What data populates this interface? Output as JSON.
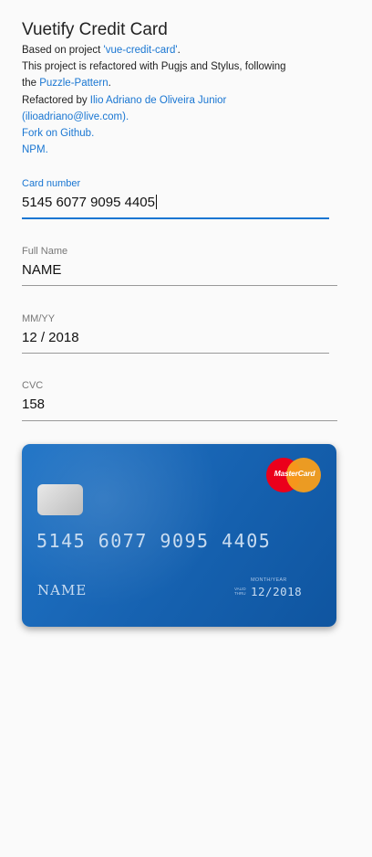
{
  "title": "Vuetify Credit Card",
  "intro": {
    "l1_text": "Based on project ",
    "l1_link": "'vue-credit-card'",
    "l1_end": ".",
    "l2_text": "This project is refactored with Pugjs and Stylus, following",
    "l3_text": "the ",
    "l3_link": "Puzzle-Pattern",
    "l3_end": ".",
    "l4_text": "Refactored by ",
    "l4_link": "Ilio Adriano de Oliveira Junior",
    "l5_link": "(ilioadriano@live.com)",
    "l5_end": ".",
    "l6_link": "Fork on Github",
    "l6_end": ".",
    "l7_link": "NPM",
    "l7_end": "."
  },
  "form": {
    "card_number_label": "Card number",
    "card_number_value": "5145 6077 9095 4405",
    "full_name_label": "Full Name",
    "full_name_value": "NAME",
    "expiry_label": "MM/YY",
    "expiry_value": "12 / 2018",
    "cvc_label": "CVC",
    "cvc_value": "158"
  },
  "card": {
    "brand": "MasterCard",
    "number": "5145 6077 9095 4405",
    "name": "NAME",
    "expiry_label": "MONTH/YEAR",
    "valid_thru": "VALID THRU",
    "expiry": "12/2018",
    "colors": {
      "start": "#1e73c6",
      "end": "#0f55a0"
    }
  },
  "colors": {
    "accent": "#1976d2"
  }
}
